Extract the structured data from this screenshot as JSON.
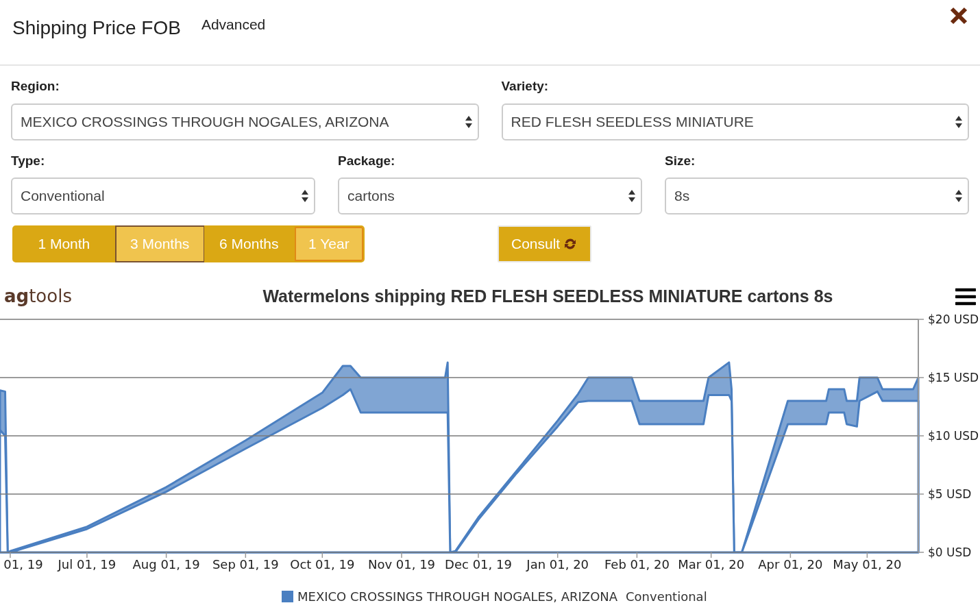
{
  "header": {
    "title": "Shipping Price FOB",
    "link": "Advanced"
  },
  "filters": [
    {
      "label": "Region:",
      "value": "MEXICO CROSSINGS THROUGH NOGALES, ARIZONA"
    },
    {
      "label": "Variety:",
      "value": "RED FLESH SEEDLESS MINIATURE"
    },
    {
      "label": "Type:",
      "value": "Conventional"
    },
    {
      "label": "Package:",
      "value": "cartons"
    },
    {
      "label": "Size:",
      "value": "8s"
    }
  ],
  "periods": [
    {
      "label": "1 Month",
      "selected": false,
      "hovered": false
    },
    {
      "label": "3 Months",
      "selected": true,
      "hovered": false
    },
    {
      "label": "6 Months",
      "selected": false,
      "hovered": false
    },
    {
      "label": "1 Year",
      "selected": false,
      "hovered": true
    }
  ],
  "consult_button": "Consult",
  "chart": {
    "logo": "**ag**tools",
    "legend_subtitle": "Conventional",
    "chart_data": {
      "type": "area",
      "grid": true,
      "title": "Watermelons shipping RED FLESH SEEDLESS MINIATURE cartons 8s",
      "x": [
        "2019-05-28",
        "2019-05-30",
        "2019-05-31",
        "2019-06-01",
        "2019-07-01",
        "2019-08-01",
        "2019-09-01",
        "2019-10-01",
        "2019-10-09",
        "2019-10-12",
        "2019-10-16",
        "2019-11-18",
        "2019-11-19",
        "2019-11-20",
        "2019-11-22",
        "2019-12-01",
        "2019-12-16",
        "2020-01-01",
        "2020-01-09",
        "2020-01-13",
        "2020-01-30",
        "2020-02-02",
        "2020-02-04",
        "2020-02-27",
        "2020-02-29",
        "2020-03-08",
        "2020-03-09",
        "2020-03-10",
        "2020-03-13",
        "2020-03-31",
        "2020-04-15",
        "2020-04-16",
        "2020-04-22",
        "2020-04-23",
        "2020-04-27",
        "2020-04-28",
        "2020-05-05",
        "2020-05-07",
        "2020-05-19",
        "2020-05-21"
      ],
      "series": [
        {
          "name": "MEXICO CROSSINGS THROUGH NOGALES, ARIZONA",
          "color": "#4a7fc1",
          "values": [
            13.9,
            13.8,
            0,
            0.1,
            2.2,
            5.6,
            9.6,
            13.7,
            16,
            16,
            15,
            15,
            16.3,
            0,
            0.1,
            3,
            7,
            11.3,
            13.6,
            15,
            15,
            13,
            13,
            13,
            15,
            16.3,
            14,
            0,
            0,
            13,
            13,
            14,
            14,
            13,
            13,
            15,
            15,
            14,
            14,
            15
          ]
        },
        {
          "color": "#4a7fc1",
          "values": [
            10.5,
            10,
            0,
            0,
            2,
            5.2,
            8.9,
            12.4,
            13.5,
            14,
            12,
            12,
            12,
            0,
            0,
            2.8,
            6.8,
            10.8,
            12.9,
            13,
            13,
            11,
            11,
            11,
            13.5,
            13.5,
            13,
            0,
            0,
            11,
            11,
            12,
            12,
            11,
            10.8,
            13,
            13.8,
            13,
            13,
            13
          ]
        }
      ],
      "xlim": [
        "2019-05-28",
        "2020-05-21"
      ],
      "ylim": [
        0,
        20
      ],
      "xticks": [
        {
          "value": "2019-06-01",
          "label": "01, 19"
        },
        {
          "value": "2019-07-01",
          "label": "Jul 01, 19"
        },
        {
          "value": "2019-08-01",
          "label": "Aug 01, 19"
        },
        {
          "value": "2019-09-01",
          "label": "Sep 01, 19"
        },
        {
          "value": "2019-10-01",
          "label": "Oct 01, 19"
        },
        {
          "value": "2019-11-01",
          "label": "Nov 01, 19"
        },
        {
          "value": "2019-12-01",
          "label": "Dec 01, 19"
        },
        {
          "value": "2020-01-01",
          "label": "Jan 01, 20"
        },
        {
          "value": "2020-02-01",
          "label": "Feb 01, 20"
        },
        {
          "value": "2020-03-01",
          "label": "Mar 01, 20"
        },
        {
          "value": "2020-04-01",
          "label": "Apr 01, 20"
        },
        {
          "value": "2020-05-01",
          "label": "May 01, 20"
        }
      ],
      "yticks": [
        {
          "value": 0,
          "label": "$0 USD"
        },
        {
          "value": 5,
          "label": "$5 USD"
        },
        {
          "value": 10,
          "label": "$10 USD"
        },
        {
          "value": 15,
          "label": "$15 USD"
        },
        {
          "value": 20,
          "label": "$20 USD"
        }
      ]
    }
  }
}
